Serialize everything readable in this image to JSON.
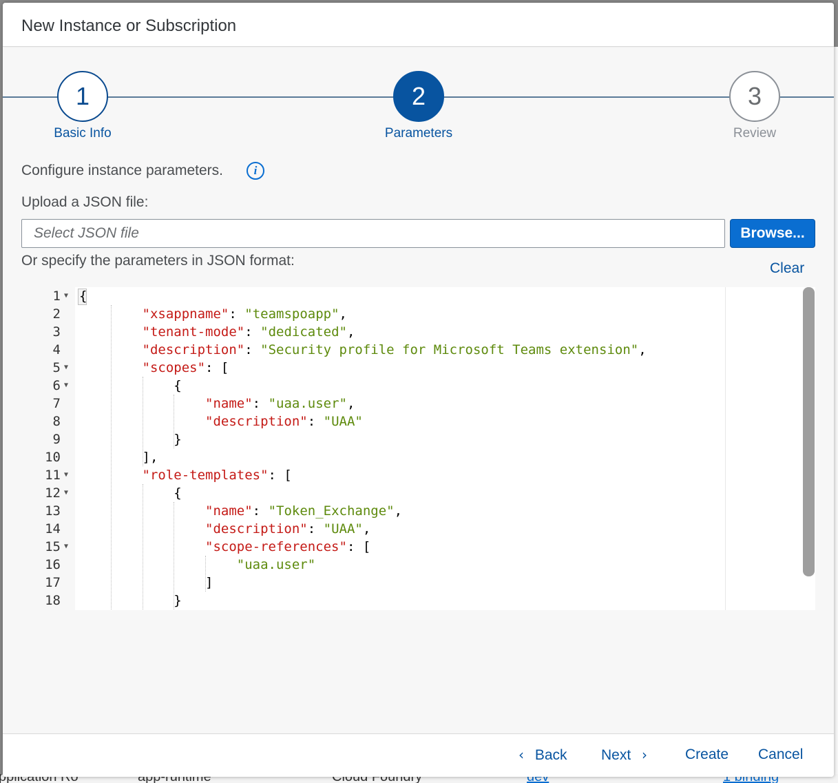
{
  "background": {
    "fragments": [
      "pplication Ro",
      "app-runtime",
      "Cloud Foundry",
      "dev",
      "1 binding"
    ]
  },
  "dialog": {
    "title": "New Instance or Subscription"
  },
  "wizard": {
    "steps": [
      {
        "number": "1",
        "label": "Basic Info",
        "state": "completed"
      },
      {
        "number": "2",
        "label": "Parameters",
        "state": "active"
      },
      {
        "number": "3",
        "label": "Review",
        "state": "disabled"
      }
    ]
  },
  "parameters": {
    "configure_text": "Configure instance parameters.",
    "info_icon": "i",
    "upload_label": "Upload a JSON file:",
    "file_placeholder": "Select JSON file",
    "file_value": "",
    "browse_label": "Browse...",
    "specify_label": "Or specify the parameters in JSON format:",
    "clear_label": "Clear"
  },
  "editor": {
    "lines": [
      {
        "num": "1",
        "fold": true,
        "code": "{"
      },
      {
        "num": "2",
        "fold": false,
        "code": "        \"xsappname\": \"teamspoapp\","
      },
      {
        "num": "3",
        "fold": false,
        "code": "        \"tenant-mode\": \"dedicated\","
      },
      {
        "num": "4",
        "fold": false,
        "code": "        \"description\": \"Security profile for Microsoft Teams extension\","
      },
      {
        "num": "5",
        "fold": true,
        "code": "        \"scopes\": ["
      },
      {
        "num": "6",
        "fold": true,
        "code": "            {"
      },
      {
        "num": "7",
        "fold": false,
        "code": "                \"name\": \"uaa.user\","
      },
      {
        "num": "8",
        "fold": false,
        "code": "                \"description\": \"UAA\""
      },
      {
        "num": "9",
        "fold": false,
        "code": "            }"
      },
      {
        "num": "10",
        "fold": false,
        "code": "        ],"
      },
      {
        "num": "11",
        "fold": true,
        "code": "        \"role-templates\": ["
      },
      {
        "num": "12",
        "fold": true,
        "code": "            {"
      },
      {
        "num": "13",
        "fold": false,
        "code": "                \"name\": \"Token_Exchange\","
      },
      {
        "num": "14",
        "fold": false,
        "code": "                \"description\": \"UAA\","
      },
      {
        "num": "15",
        "fold": true,
        "code": "                \"scope-references\": ["
      },
      {
        "num": "16",
        "fold": false,
        "code": "                    \"uaa.user\""
      },
      {
        "num": "17",
        "fold": false,
        "code": "                ]"
      },
      {
        "num": "18",
        "fold": false,
        "code": "            }"
      }
    ]
  },
  "footer": {
    "back_label": "Back",
    "next_label": "Next",
    "create_label": "Create",
    "cancel_label": "Cancel"
  },
  "colors": {
    "accent": "#0854a0",
    "button": "#0a6ed1",
    "json_key": "#c41a16",
    "json_string": "#5d8a0c"
  }
}
